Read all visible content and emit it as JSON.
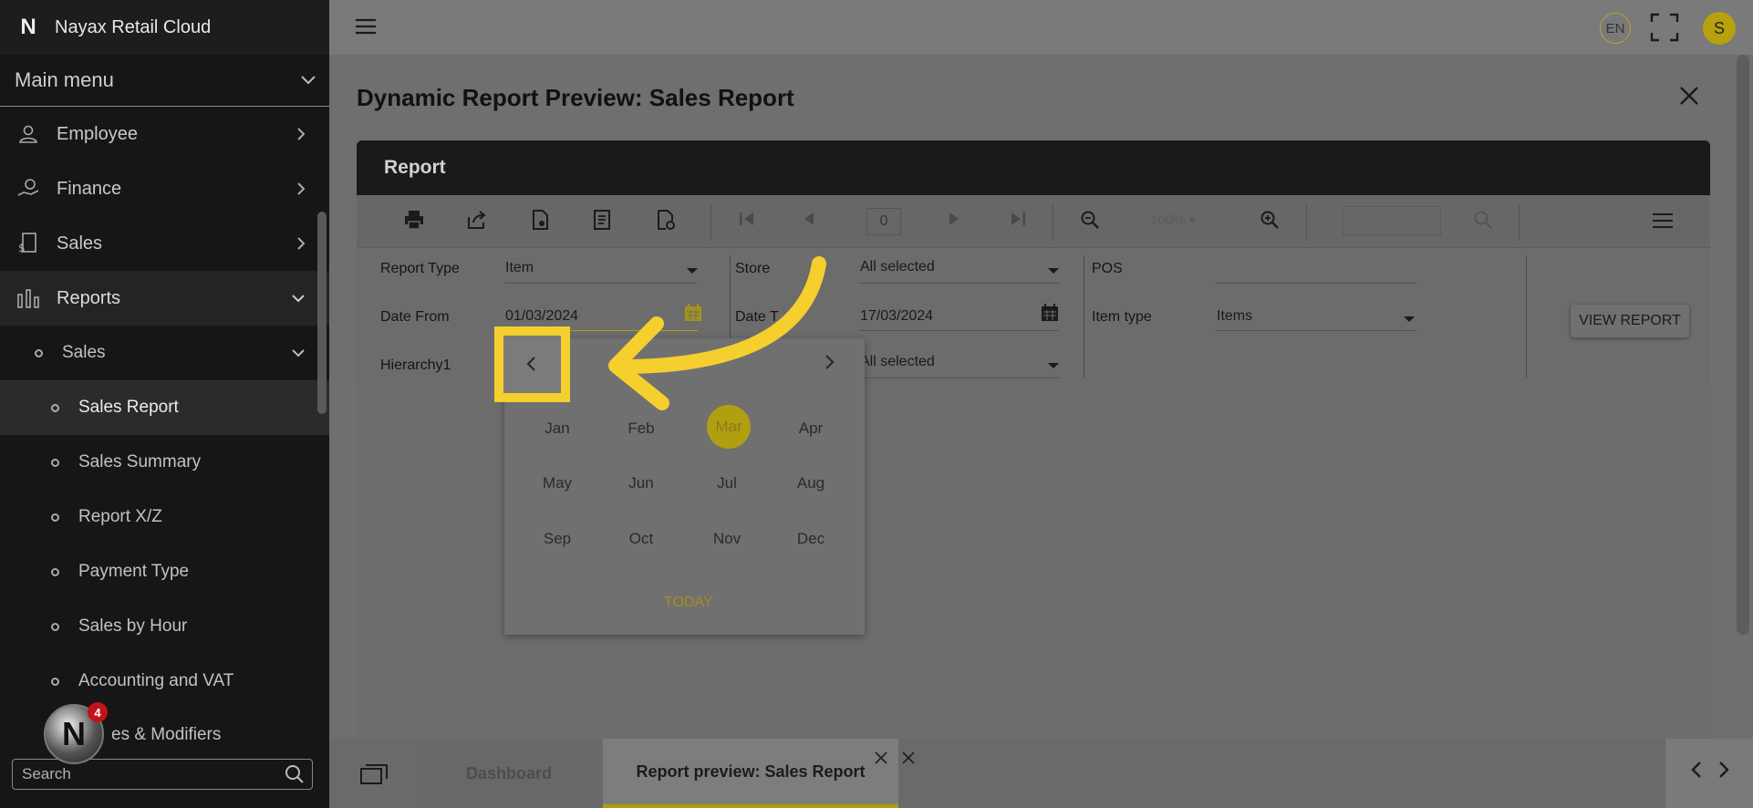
{
  "app": {
    "title": "Nayax Retail Cloud",
    "logo_letter": "N"
  },
  "sidebar": {
    "main_menu_label": "Main menu",
    "items": [
      {
        "label": "Employee",
        "icon": "person-icon"
      },
      {
        "label": "Finance",
        "icon": "hand-coin-icon"
      },
      {
        "label": "Sales",
        "icon": "receipt-dollar-icon"
      },
      {
        "label": "Reports",
        "icon": "bar-chart-icon"
      }
    ],
    "sub_parent": "Sales",
    "sub_items": [
      "Sales Report",
      "Sales Summary",
      "Report X/Z",
      "Payment Type",
      "Sales by Hour",
      "Accounting and VAT",
      "es & Modifiers"
    ],
    "search_placeholder": "Search",
    "notification_count": "4"
  },
  "topbar": {
    "language": "EN",
    "user_initial": "S"
  },
  "page": {
    "title": "Dynamic Report Preview: Sales Report"
  },
  "report": {
    "header": "Report",
    "page_number": "0",
    "zoom": "100%",
    "params": {
      "report_type_label": "Report Type",
      "report_type_value": "Item",
      "date_from_label": "Date From",
      "date_from_value": "01/03/2024",
      "hierarchy_label": "Hierarchy1",
      "store_label": "Store",
      "store_value": "All selected",
      "date_to_label": "Date T",
      "date_to_value": "17/03/2024",
      "third_value": "All selected",
      "pos_label": "POS",
      "item_type_label": "Item type",
      "item_type_value": "Items"
    },
    "view_button": "VIEW REPORT"
  },
  "picker": {
    "months": [
      "Jan",
      "Feb",
      "Mar",
      "Apr",
      "May",
      "Jun",
      "Jul",
      "Aug",
      "Sep",
      "Oct",
      "Nov",
      "Dec"
    ],
    "selected": "Mar",
    "today": "TODAY"
  },
  "tabs": [
    {
      "label": "Dashboard",
      "active": false
    },
    {
      "label": "Report preview: Sales Report",
      "active": true
    }
  ],
  "colors": {
    "accent": "#b29f10",
    "highlight": "#f4cf2d",
    "sidebar": "#161616"
  }
}
